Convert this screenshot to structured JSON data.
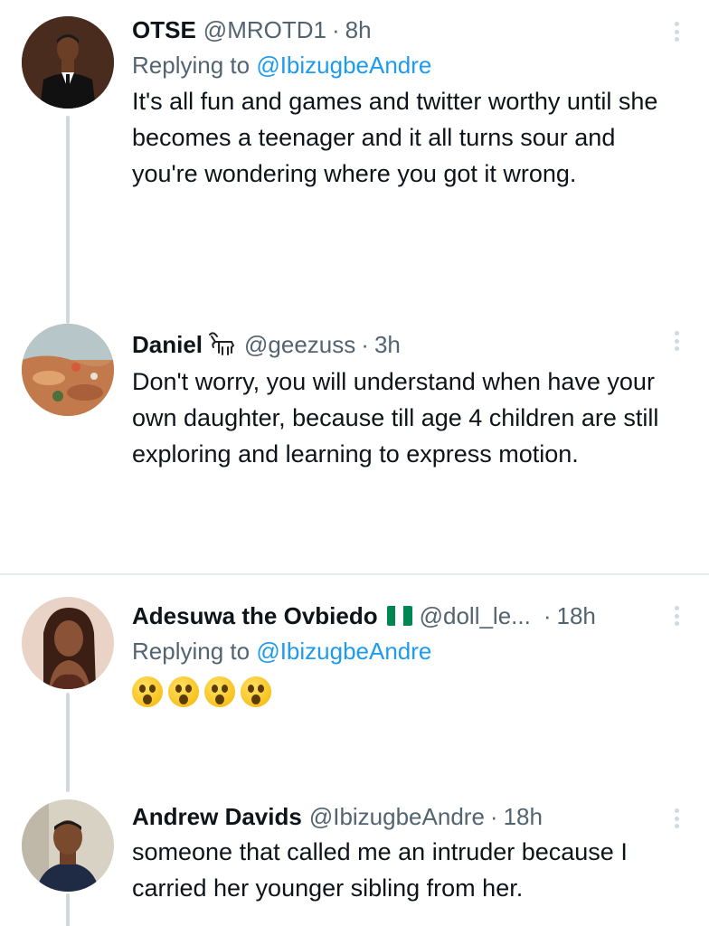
{
  "tweets": [
    {
      "name": "OTSE",
      "handle": "@MROTD1",
      "separator": "·",
      "time": "8h",
      "replying_prefix": "Replying to ",
      "replying_handle": "@IbizugbeAndre",
      "text": "It's all fun and games and twitter worthy until she becomes a teenager and it all turns sour and you're wondering where you got it wrong."
    },
    {
      "name": "Daniel",
      "handle": "@geezuss",
      "separator": "·",
      "time": "3h",
      "text": "Don't worry, you will understand when have your own daughter, because till age 4 children are still exploring and learning to express motion."
    },
    {
      "name": "Adesuwa the Ovbiedo",
      "handle": "@doll_le...",
      "separator": "·",
      "time": "18h",
      "replying_prefix": "Replying to ",
      "replying_handle": "@IbizugbeAndre",
      "emoji": [
        "😲",
        "😲",
        "😲",
        "😲"
      ]
    },
    {
      "name": "Andrew Davids",
      "handle": "@IbizugbeAndre",
      "separator": "·",
      "time": "18h",
      "text": "someone that called me an intruder because I carried her younger sibling from her."
    }
  ],
  "icons": {
    "more": "more-vertical-icon",
    "flag": "nigeria-flag-icon",
    "goat": "goat-icon"
  },
  "colors": {
    "link": "#1d9bf0",
    "secondary_text": "#536471",
    "thread_line": "#cfd9de",
    "flag_green": "#008751"
  }
}
